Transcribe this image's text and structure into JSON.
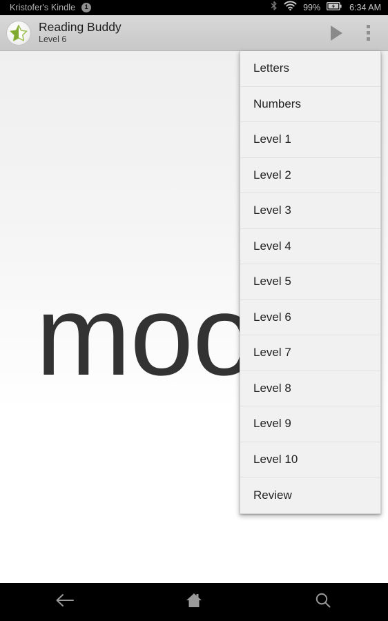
{
  "status_bar": {
    "device_name": "Kristofer's Kindle",
    "notification_count": "1",
    "bluetooth_icon": "bluetooth-icon",
    "wifi_icon": "wifi-icon",
    "battery_percent": "99%",
    "battery_icon": "battery-charging-icon",
    "time": "6:34 AM",
    "background_color": "#000000",
    "text_color": "#c9c9c9"
  },
  "app_bar": {
    "app_icon": "star-icon",
    "title": "Reading Buddy",
    "subtitle": "Level 6",
    "play_button_icon": "play-icon",
    "overflow_button_icon": "overflow-menu-icon",
    "background_color": "#cfcfcf",
    "icon_color": "#8a8a8a"
  },
  "content": {
    "word": "moo",
    "text_color": "#333333",
    "background_color": "#ffffff"
  },
  "menu": {
    "background_color": "#f1f1f1",
    "text_color": "#232323",
    "items": [
      {
        "label": "Letters"
      },
      {
        "label": "Numbers"
      },
      {
        "label": "Level 1"
      },
      {
        "label": "Level 2"
      },
      {
        "label": "Level 3"
      },
      {
        "label": "Level 4"
      },
      {
        "label": "Level 5"
      },
      {
        "label": "Level 6"
      },
      {
        "label": "Level 7"
      },
      {
        "label": "Level 8"
      },
      {
        "label": "Level 9"
      },
      {
        "label": "Level 10"
      },
      {
        "label": "Review"
      }
    ]
  },
  "nav_bar": {
    "background_color": "#000000",
    "icon_color": "#9a9a9a",
    "buttons": [
      {
        "name": "back-icon"
      },
      {
        "name": "home-icon"
      },
      {
        "name": "search-icon"
      }
    ]
  }
}
